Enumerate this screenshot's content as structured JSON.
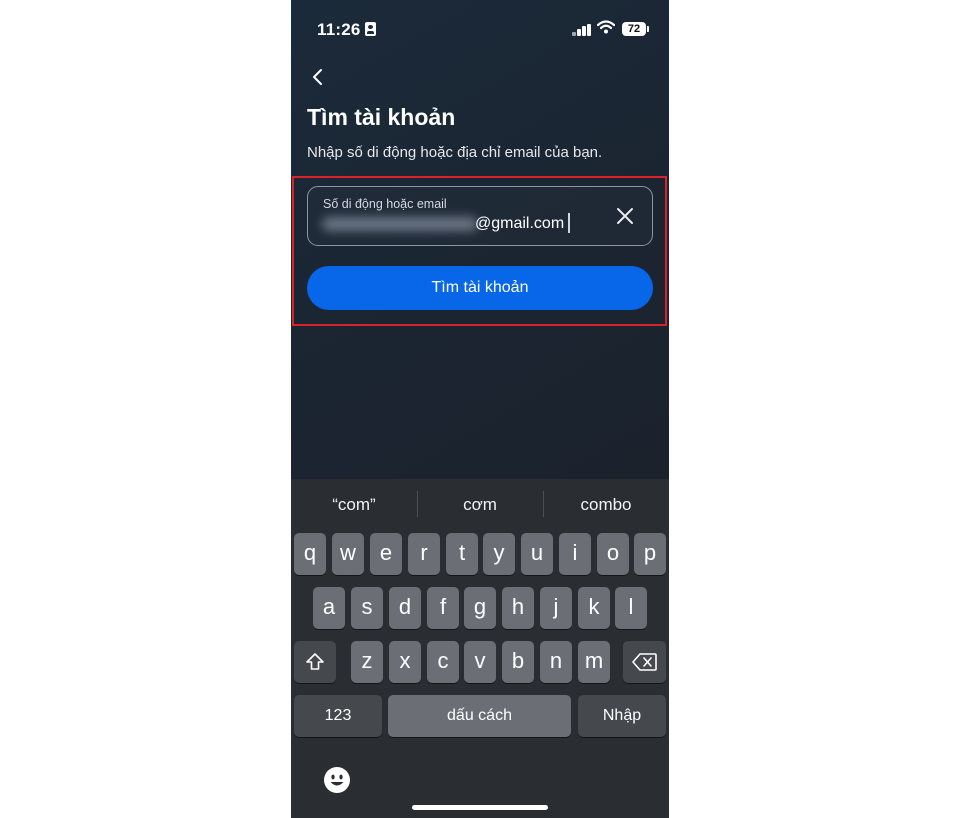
{
  "status_bar": {
    "time": "11:26",
    "battery": "72"
  },
  "header": {
    "title": "Tìm tài khoản",
    "subtitle": "Nhập số di động hoặc địa chỉ email của bạn."
  },
  "form": {
    "input_label": "Số di động hoặc email",
    "input_value_visible": "@gmail.com",
    "submit_label": "Tìm tài khoản"
  },
  "keyboard": {
    "suggestions": [
      "“com”",
      "cơm",
      "combo"
    ],
    "row1": [
      "q",
      "w",
      "e",
      "r",
      "t",
      "y",
      "u",
      "i",
      "o",
      "p"
    ],
    "row2": [
      "a",
      "s",
      "d",
      "f",
      "g",
      "h",
      "j",
      "k",
      "l"
    ],
    "row3": [
      "z",
      "x",
      "c",
      "v",
      "b",
      "n",
      "m"
    ],
    "numbers_label": "123",
    "space_label": "dấu cách",
    "return_label": "Nhập"
  },
  "colors": {
    "accent": "#0866e8",
    "highlight": "#d8232a",
    "keyboard_bg": "#2a2d31",
    "key_bg": "#6b6f75"
  },
  "icons": [
    "back-chevron-icon",
    "clear-x-icon",
    "shift-icon",
    "backspace-icon",
    "emoji-icon",
    "signal-icon",
    "wifi-icon",
    "battery-icon",
    "id-card-icon"
  ]
}
